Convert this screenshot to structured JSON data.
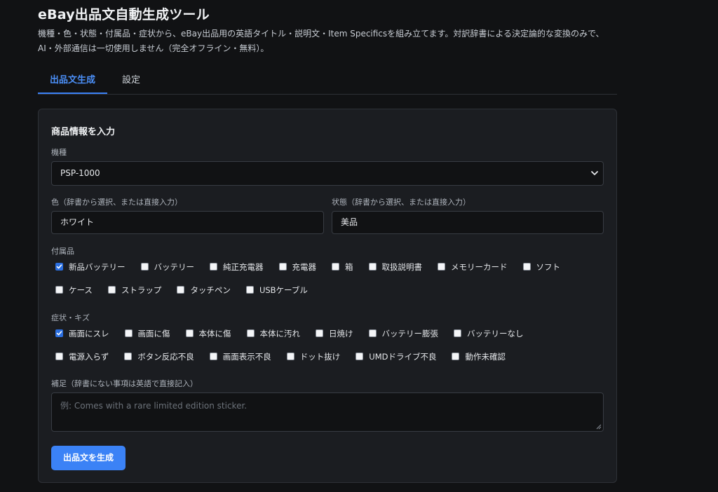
{
  "header": {
    "title": "eBay出品文自動生成ツール",
    "description": "機種・色・状態・付属品・症状から、eBay出品用の英語タイトル・説明文・Item Specificsを組み立てます。対訳辞書による決定論的な変換のみで、AI・外部通信は一切使用しません（完全オフライン・無料）。"
  },
  "tabs": [
    {
      "label": "出品文生成",
      "active": true
    },
    {
      "label": "設定",
      "active": false
    }
  ],
  "form": {
    "heading": "商品情報を入力",
    "model": {
      "label": "機種",
      "value": "PSP-1000"
    },
    "color": {
      "label": "色（辞書から選択、または直接入力）",
      "value": "ホワイト"
    },
    "condition": {
      "label": "状態（辞書から選択、または直接入力）",
      "value": "美品"
    },
    "accessories": {
      "label": "付属品",
      "rows": [
        [
          {
            "label": "新品バッテリー",
            "checked": true
          },
          {
            "label": "バッテリー",
            "checked": false
          },
          {
            "label": "純正充電器",
            "checked": false
          },
          {
            "label": "充電器",
            "checked": false
          },
          {
            "label": "箱",
            "checked": false
          },
          {
            "label": "取扱説明書",
            "checked": false
          },
          {
            "label": "メモリーカード",
            "checked": false
          },
          {
            "label": "ソフト",
            "checked": false
          }
        ],
        [
          {
            "label": "ケース",
            "checked": false
          },
          {
            "label": "ストラップ",
            "checked": false
          },
          {
            "label": "タッチペン",
            "checked": false
          },
          {
            "label": "USBケーブル",
            "checked": false
          }
        ]
      ]
    },
    "symptoms": {
      "label": "症状・キズ",
      "rows": [
        [
          {
            "label": "画面にスレ",
            "checked": true
          },
          {
            "label": "画面に傷",
            "checked": false
          },
          {
            "label": "本体に傷",
            "checked": false
          },
          {
            "label": "本体に汚れ",
            "checked": false
          },
          {
            "label": "日焼け",
            "checked": false
          },
          {
            "label": "バッテリー膨張",
            "checked": false
          },
          {
            "label": "バッテリーなし",
            "checked": false
          }
        ],
        [
          {
            "label": "電源入らず",
            "checked": false
          },
          {
            "label": "ボタン反応不良",
            "checked": false
          },
          {
            "label": "画面表示不良",
            "checked": false
          },
          {
            "label": "ドット抜け",
            "checked": false
          },
          {
            "label": "UMDドライブ不良",
            "checked": false
          },
          {
            "label": "動作未確認",
            "checked": false
          }
        ]
      ]
    },
    "notes": {
      "label": "補足（辞書にない事項は英語で直接記入）",
      "placeholder": "例: Comes with a rare limited edition sticker."
    },
    "generate_button": "出品文を生成"
  },
  "colors": {
    "background": "#111214",
    "card": "#1b1d21",
    "accent": "#3b82f6",
    "checkbox_checked": "#2b6fe0"
  },
  "icons": {
    "select_chevron": "chevron-down-icon",
    "checkmark": "check-icon",
    "textarea_resize": "resize-grip-icon"
  }
}
